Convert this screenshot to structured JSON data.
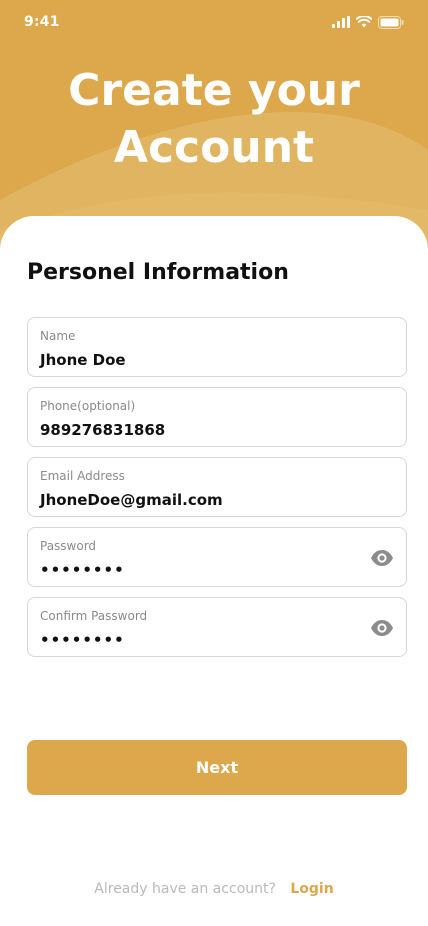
{
  "status_bar": {
    "time": "9:41"
  },
  "header": {
    "title_line1": "Create your",
    "title_line2": "Account"
  },
  "form": {
    "section_title": "Personel Information",
    "fields": [
      {
        "label": "Name",
        "value": "Jhone Doe"
      },
      {
        "label": "Phone(optional)",
        "value": "989276831868"
      },
      {
        "label": "Email Address",
        "value": "JhoneDoe@gmail.com"
      },
      {
        "label": "Password",
        "value": "••••••••"
      },
      {
        "label": "Confirm Password",
        "value": "••••••••"
      }
    ],
    "next_label": "Next"
  },
  "footer": {
    "prompt": "Already have an account?",
    "login_label": "Login"
  },
  "colors": {
    "accent": "#dca84b",
    "border": "#d6d6d6",
    "muted": "#b9b9b9"
  }
}
